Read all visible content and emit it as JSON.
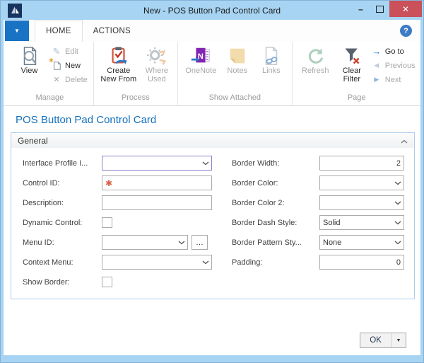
{
  "window": {
    "title": "New - POS Button Pad Control Card",
    "minimize_glyph": "–",
    "close_glyph": "✕"
  },
  "app_menu": {
    "arrow": "▼"
  },
  "tabs": {
    "home": "HOME",
    "actions": "ACTIONS"
  },
  "help": {
    "glyph": "?"
  },
  "ribbon": {
    "buttons": {
      "view": "View",
      "edit": "Edit",
      "new": "New",
      "delete": "Delete",
      "create_line1": "Create",
      "create_line2": "New From",
      "where_line1": "Where",
      "where_line2": "Used",
      "onenote": "OneNote",
      "notes": "Notes",
      "links": "Links",
      "refresh": "Refresh",
      "clear_line1": "Clear",
      "clear_line2": "Filter",
      "goto": "Go to",
      "previous": "Previous",
      "next": "Next"
    },
    "group_labels": {
      "manage": "Manage",
      "process": "Process",
      "show_attached": "Show Attached",
      "page": "Page"
    },
    "glyphs": {
      "edit": "✎",
      "delete": "✕",
      "new_star": "✱",
      "goto": "→",
      "previous": "◀",
      "next": "▶"
    }
  },
  "page": {
    "title": "POS Button Pad Control Card"
  },
  "general": {
    "header": "General",
    "required_marker": "✱",
    "assist_glyph": "…",
    "left": [
      {
        "label": "Interface Profile I...",
        "value": "",
        "control": "combobox",
        "focused": true
      },
      {
        "label": "Control ID:",
        "value": "",
        "control": "text",
        "required": true
      },
      {
        "label": "Description:",
        "value": "",
        "control": "text"
      },
      {
        "label": "Dynamic Control:",
        "control": "checkbox",
        "checked": false
      },
      {
        "label": "Menu ID:",
        "value": "",
        "control": "combobox-assist"
      },
      {
        "label": "Context Menu:",
        "value": "",
        "control": "combobox"
      },
      {
        "label": "Show Border:",
        "control": "checkbox",
        "checked": false
      }
    ],
    "right": [
      {
        "label": "Border Width:",
        "value": "2",
        "control": "number"
      },
      {
        "label": "Border Color:",
        "value": "",
        "control": "combobox"
      },
      {
        "label": "Border Color 2:",
        "value": "",
        "control": "combobox"
      },
      {
        "label": "Border Dash Style:",
        "value": "Solid",
        "control": "combobox"
      },
      {
        "label": "Border Pattern Sty...",
        "value": "None",
        "control": "combobox"
      },
      {
        "label": "Padding:",
        "value": "0",
        "control": "number"
      }
    ]
  },
  "footer": {
    "ok": "OK",
    "dropdown": "▼"
  },
  "colors": {
    "titlebar": "#a6d4f2",
    "accent_blue": "#1973c5",
    "close_red": "#ca5059",
    "page_title_blue": "#1570bd",
    "required_red": "#d9644a",
    "focus_border": "#8583c8",
    "fasttab_border": "#aecce8",
    "disabled_text": "#a9a9a9",
    "group_label": "#9b9b9b"
  }
}
